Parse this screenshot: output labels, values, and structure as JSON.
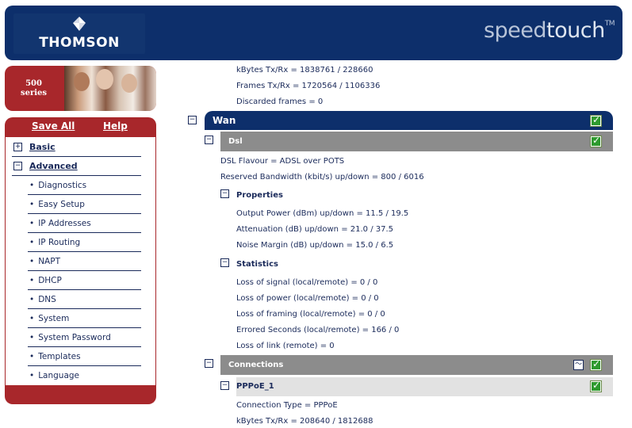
{
  "header": {
    "logo_text": "THOMSON",
    "brand_prefix": "speed",
    "brand_suffix": "touch",
    "brand_tm": "TM"
  },
  "series": {
    "number": "500",
    "word": "series"
  },
  "nav": {
    "save_all": "Save All",
    "help": "Help",
    "basic": "Basic",
    "advanced": "Advanced",
    "items": [
      "Diagnostics",
      "Easy Setup",
      "IP Addresses",
      "IP Routing",
      "NAPT",
      "DHCP",
      "DNS",
      "System",
      "System Password",
      "Templates",
      "Language"
    ]
  },
  "main": {
    "top_stats": [
      "kBytes Tx/Rx = 1838761 / 228660",
      "Frames Tx/Rx = 1720564 / 1106336",
      "Discarded frames = 0"
    ],
    "wan_title": "Wan",
    "dsl_title": "Dsl",
    "dsl_flavour": "DSL Flavour = ADSL over POTS",
    "reserved_bw": "Reserved Bandwidth (kbit/s) up/down = 800 / 6016",
    "properties_title": "Properties",
    "properties": [
      "Output Power (dBm) up/down = 11.5 / 19.5",
      "Attenuation (dB) up/down = 21.0 / 37.5",
      "Noise Margin (dB) up/down = 15.0 / 6.5"
    ],
    "statistics_title": "Statistics",
    "statistics": [
      "Loss of signal (local/remote) = 0 / 0",
      "Loss of power (local/remote) = 0 / 0",
      "Loss of framing (local/remote) = 0 / 0",
      "Errored Seconds (local/remote) = 166 / 0",
      "Loss of link (remote) = 0"
    ],
    "connections_title": "Connections",
    "pppoe_title": "PPPoE_1",
    "pppoe_stats": [
      "Connection Type = PPPoE",
      "kBytes Tx/Rx = 208640 / 1812688"
    ]
  },
  "colors": {
    "header_bg": "#0d2f6b",
    "accent_red": "#a8272b",
    "wan_bar": "#0d2f6b",
    "dsl_bar": "#8c8c8c",
    "pppoe_bar": "#e2e2e2",
    "check_green": "#2e9a2e"
  },
  "icons": {
    "expand": "plus-box-icon",
    "collapse": "minus-box-icon",
    "enabled": "green-check-icon",
    "graph": "graph-icon"
  }
}
